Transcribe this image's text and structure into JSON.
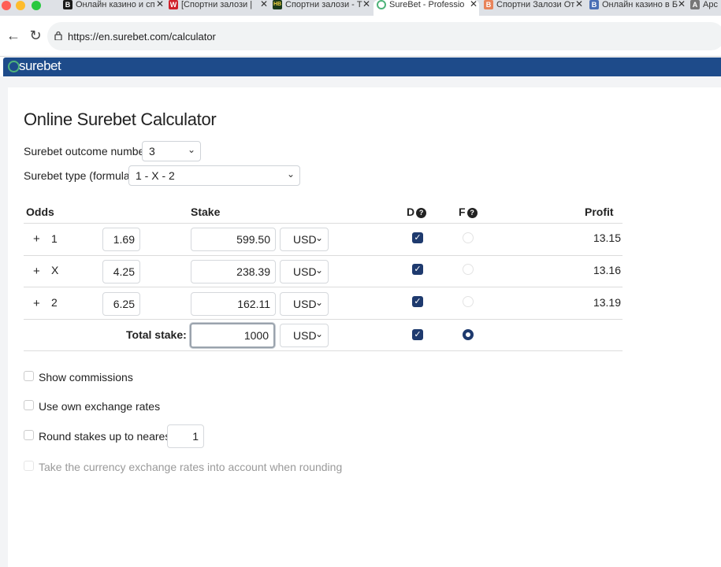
{
  "browser": {
    "tabs": [
      {
        "title": "Онлайн казино и сп",
        "favicon": "B",
        "color": "#1a1a1a"
      },
      {
        "title": "[Спортни залози |",
        "favicon": "W",
        "color": "#d0202a"
      },
      {
        "title": "Спортни залози - Т",
        "favicon": "HB",
        "color": "#1a3a1a"
      },
      {
        "title": "SureBet - Professio",
        "favicon": "globe",
        "color": "#4fb37a",
        "active": true
      },
      {
        "title": "Спортни Залози От",
        "favicon": "B",
        "color": "#e8835a"
      },
      {
        "title": "Онлайн казино в Б",
        "favicon": "B",
        "color": "#4a6fb5"
      },
      {
        "title": "Арс",
        "favicon": "A",
        "color": "#777"
      }
    ],
    "url": "https://en.surebet.com/calculator"
  },
  "site": {
    "logo": "surebet"
  },
  "calculator": {
    "title": "Online Surebet Calculator",
    "outcome_label": "Surebet outcome number:",
    "outcome_value": "3",
    "type_label": "Surebet type (formula):",
    "type_value": "1 - X - 2",
    "headers": {
      "odds": "Odds",
      "stake": "Stake",
      "d": "D",
      "f": "F",
      "profit": "Profit"
    },
    "rows": [
      {
        "plus": "+",
        "outcome": "1",
        "odds": "1.69",
        "stake": "599.50",
        "currency": "USD",
        "d_checked": true,
        "f_selected": false,
        "profit": "13.15"
      },
      {
        "plus": "+",
        "outcome": "X",
        "odds": "4.25",
        "stake": "238.39",
        "currency": "USD",
        "d_checked": true,
        "f_selected": false,
        "profit": "13.16"
      },
      {
        "plus": "+",
        "outcome": "2",
        "odds": "6.25",
        "stake": "162.11",
        "currency": "USD",
        "d_checked": true,
        "f_selected": false,
        "profit": "13.19"
      }
    ],
    "total": {
      "label": "Total stake:",
      "value": "1000",
      "currency": "USD",
      "d_checked": true,
      "f_selected": true
    },
    "options": [
      {
        "label": "Show commissions",
        "checked": false,
        "disabled": false
      },
      {
        "label": "Use own exchange rates",
        "checked": false,
        "disabled": false
      },
      {
        "label": "Round stakes up to nearest:",
        "checked": false,
        "disabled": false,
        "value": "1"
      },
      {
        "label": "Take the currency exchange rates into account when rounding",
        "checked": false,
        "disabled": true
      }
    ],
    "colors": {
      "header_bar": "#1e4b8a",
      "checkbox": "#1e3a6e",
      "logo_green": "#4fb37a"
    }
  }
}
